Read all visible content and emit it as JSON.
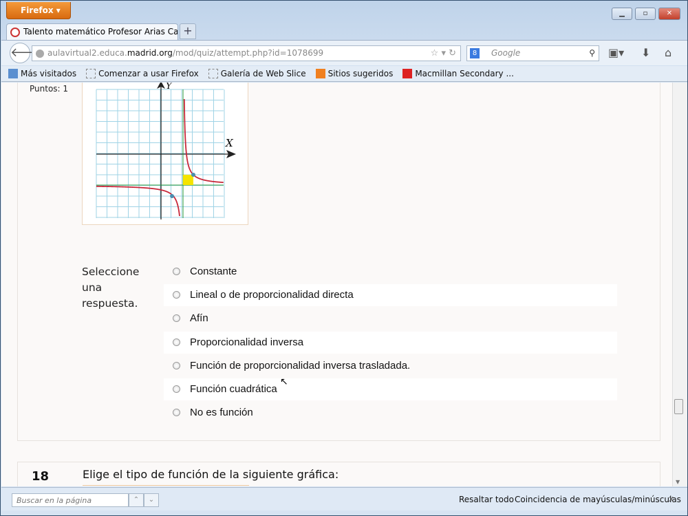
{
  "browser": {
    "menu_button": "Firefox",
    "tab_title": "Talento matemático Profesor Arias Cabe...",
    "new_tab": "+",
    "url_host_pre": "aulavirtual2.educa.",
    "url_host": "madrid.org",
    "url_path": "/mod/quiz/attempt.php?id=1078699",
    "search_placeholder": "Google",
    "bookmarks": [
      "Más visitados",
      "Comenzar a usar Firefox",
      "Galería de Web Slice",
      "Sitios sugeridos",
      "Macmillan Secondary ..."
    ]
  },
  "question17": {
    "points": "Puntos: 1",
    "select_prompt": "Seleccione una respuesta.",
    "options": [
      "Constante",
      "Lineal o de proporcionalidad directa",
      "Afín",
      "Proporcionalidad inversa",
      "Función de proporcionalidad inversa trasladada.",
      "Función cuadrática",
      "No es función"
    ],
    "graph": {
      "x_label": "X",
      "y_label": "Y"
    }
  },
  "question18": {
    "number": "18",
    "text": "Elige el tipo de función de la siguiente gráfica:"
  },
  "findbar": {
    "placeholder": "Buscar en la página",
    "highlight_all": "Resaltar todo",
    "match_case": "Coincidencia de mayúsculas/minúsculas",
    "close": "x"
  }
}
